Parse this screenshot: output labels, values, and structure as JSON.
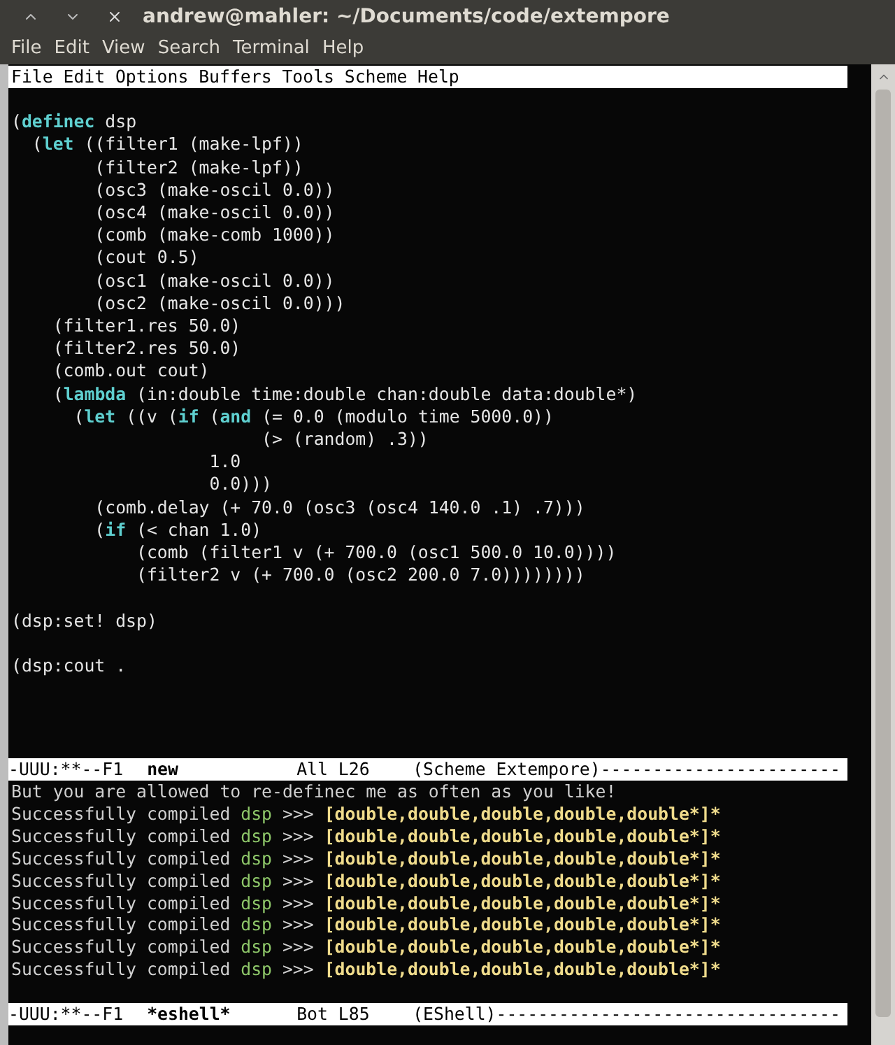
{
  "window": {
    "title": "andrew@mahler: ~/Documents/code/extempore"
  },
  "terminal_menu": [
    "File",
    "Edit",
    "View",
    "Search",
    "Terminal",
    "Help"
  ],
  "emacs_menu": [
    "File",
    "Edit",
    "Options",
    "Buffers",
    "Tools",
    "Scheme",
    "Help"
  ],
  "code_lines": [
    {
      "kind": "blank"
    },
    {
      "kind": "code",
      "segments": [
        {
          "kind": "plain",
          "text": "("
        },
        {
          "kind": "keyword",
          "text": "definec"
        },
        {
          "kind": "plain",
          "text": " dsp"
        }
      ]
    },
    {
      "kind": "code",
      "segments": [
        {
          "kind": "plain",
          "text": "  ("
        },
        {
          "kind": "keyword",
          "text": "let"
        },
        {
          "kind": "plain",
          "text": " ((filter1 (make-lpf))"
        }
      ]
    },
    {
      "kind": "code",
      "segments": [
        {
          "kind": "plain",
          "text": "        (filter2 (make-lpf))"
        }
      ]
    },
    {
      "kind": "code",
      "segments": [
        {
          "kind": "plain",
          "text": "        (osc3 (make-oscil 0.0))"
        }
      ]
    },
    {
      "kind": "code",
      "segments": [
        {
          "kind": "plain",
          "text": "        (osc4 (make-oscil 0.0))"
        }
      ]
    },
    {
      "kind": "code",
      "segments": [
        {
          "kind": "plain",
          "text": "        (comb (make-comb 1000))"
        }
      ]
    },
    {
      "kind": "code",
      "segments": [
        {
          "kind": "plain",
          "text": "        (cout 0.5)"
        }
      ]
    },
    {
      "kind": "code",
      "segments": [
        {
          "kind": "plain",
          "text": "        (osc1 (make-oscil 0.0))"
        }
      ]
    },
    {
      "kind": "code",
      "segments": [
        {
          "kind": "plain",
          "text": "        (osc2 (make-oscil 0.0)))"
        }
      ]
    },
    {
      "kind": "code",
      "segments": [
        {
          "kind": "plain",
          "text": "    (filter1.res 50.0)"
        }
      ]
    },
    {
      "kind": "code",
      "segments": [
        {
          "kind": "plain",
          "text": "    (filter2.res 50.0)"
        }
      ]
    },
    {
      "kind": "code",
      "segments": [
        {
          "kind": "plain",
          "text": "    (comb.out cout)"
        }
      ]
    },
    {
      "kind": "code",
      "segments": [
        {
          "kind": "plain",
          "text": "    ("
        },
        {
          "kind": "keyword",
          "text": "lambda"
        },
        {
          "kind": "plain",
          "text": " (in:double time:double chan:double data:double*)"
        }
      ]
    },
    {
      "kind": "code",
      "segments": [
        {
          "kind": "plain",
          "text": "      ("
        },
        {
          "kind": "keyword",
          "text": "let"
        },
        {
          "kind": "plain",
          "text": " ((v ("
        },
        {
          "kind": "keyword",
          "text": "if"
        },
        {
          "kind": "plain",
          "text": " ("
        },
        {
          "kind": "keyword",
          "text": "and"
        },
        {
          "kind": "plain",
          "text": " (= 0.0 (modulo time 5000.0))"
        }
      ]
    },
    {
      "kind": "code",
      "segments": [
        {
          "kind": "plain",
          "text": "                        (> (random) .3))"
        }
      ]
    },
    {
      "kind": "code",
      "segments": [
        {
          "kind": "plain",
          "text": "                   1.0"
        }
      ]
    },
    {
      "kind": "code",
      "segments": [
        {
          "kind": "plain",
          "text": "                   0.0)))"
        }
      ]
    },
    {
      "kind": "code",
      "segments": [
        {
          "kind": "plain",
          "text": "        (comb.delay (+ 70.0 (osc3 (osc4 140.0 .1) .7)))"
        }
      ]
    },
    {
      "kind": "code",
      "segments": [
        {
          "kind": "plain",
          "text": "        ("
        },
        {
          "kind": "keyword",
          "text": "if"
        },
        {
          "kind": "plain",
          "text": " (< chan 1.0)"
        }
      ]
    },
    {
      "kind": "code",
      "segments": [
        {
          "kind": "plain",
          "text": "            (comb (filter1 v (+ 700.0 (osc1 500.0 10.0))))"
        }
      ]
    },
    {
      "kind": "code",
      "segments": [
        {
          "kind": "plain",
          "text": "            (filter2 v (+ 700.0 (osc2 200.0 7.0))))))))"
        }
      ]
    },
    {
      "kind": "blank"
    },
    {
      "kind": "code",
      "segments": [
        {
          "kind": "plain",
          "text": "(dsp:set! dsp)"
        }
      ]
    },
    {
      "kind": "blank"
    },
    {
      "kind": "code",
      "segments": [
        {
          "kind": "plain",
          "text": "(dsp:cout ."
        }
      ]
    }
  ],
  "mode_line_top": {
    "status": "-UUU:**--F1",
    "buffer": "new",
    "position": "All L26",
    "mode": "(Scheme Extempore)",
    "fill": "-----------------------"
  },
  "eshell_lines": [
    {
      "segments": [
        {
          "kind": "plain",
          "text": "But you are allowed to re-definec me as often as you like!"
        }
      ]
    },
    {
      "segments": [
        {
          "kind": "plain",
          "text": "Successfully compiled "
        },
        {
          "kind": "name",
          "text": "dsp"
        },
        {
          "kind": "plain",
          "text": " >>> "
        },
        {
          "kind": "type",
          "text": "[double,double,double,double,double*]*"
        }
      ]
    },
    {
      "segments": [
        {
          "kind": "plain",
          "text": "Successfully compiled "
        },
        {
          "kind": "name",
          "text": "dsp"
        },
        {
          "kind": "plain",
          "text": " >>> "
        },
        {
          "kind": "type",
          "text": "[double,double,double,double,double*]*"
        }
      ]
    },
    {
      "segments": [
        {
          "kind": "plain",
          "text": "Successfully compiled "
        },
        {
          "kind": "name",
          "text": "dsp"
        },
        {
          "kind": "plain",
          "text": " >>> "
        },
        {
          "kind": "type",
          "text": "[double,double,double,double,double*]*"
        }
      ]
    },
    {
      "segments": [
        {
          "kind": "plain",
          "text": "Successfully compiled "
        },
        {
          "kind": "name",
          "text": "dsp"
        },
        {
          "kind": "plain",
          "text": " >>> "
        },
        {
          "kind": "type",
          "text": "[double,double,double,double,double*]*"
        }
      ]
    },
    {
      "segments": [
        {
          "kind": "plain",
          "text": "Successfully compiled "
        },
        {
          "kind": "name",
          "text": "dsp"
        },
        {
          "kind": "plain",
          "text": " >>> "
        },
        {
          "kind": "type",
          "text": "[double,double,double,double,double*]*"
        }
      ]
    },
    {
      "segments": [
        {
          "kind": "plain",
          "text": "Successfully compiled "
        },
        {
          "kind": "name",
          "text": "dsp"
        },
        {
          "kind": "plain",
          "text": " >>> "
        },
        {
          "kind": "type",
          "text": "[double,double,double,double,double*]*"
        }
      ]
    },
    {
      "segments": [
        {
          "kind": "plain",
          "text": "Successfully compiled "
        },
        {
          "kind": "name",
          "text": "dsp"
        },
        {
          "kind": "plain",
          "text": " >>> "
        },
        {
          "kind": "type",
          "text": "[double,double,double,double,double*]*"
        }
      ]
    },
    {
      "segments": [
        {
          "kind": "plain",
          "text": "Successfully compiled "
        },
        {
          "kind": "name",
          "text": "dsp"
        },
        {
          "kind": "plain",
          "text": " >>> "
        },
        {
          "kind": "type",
          "text": "[double,double,double,double,double*]*"
        }
      ]
    }
  ],
  "mode_line_bottom": {
    "status": "-UUU:**--F1",
    "buffer": "*eshell*",
    "position": "Bot L85",
    "mode": "(EShell)",
    "fill": "---------------------------------"
  }
}
